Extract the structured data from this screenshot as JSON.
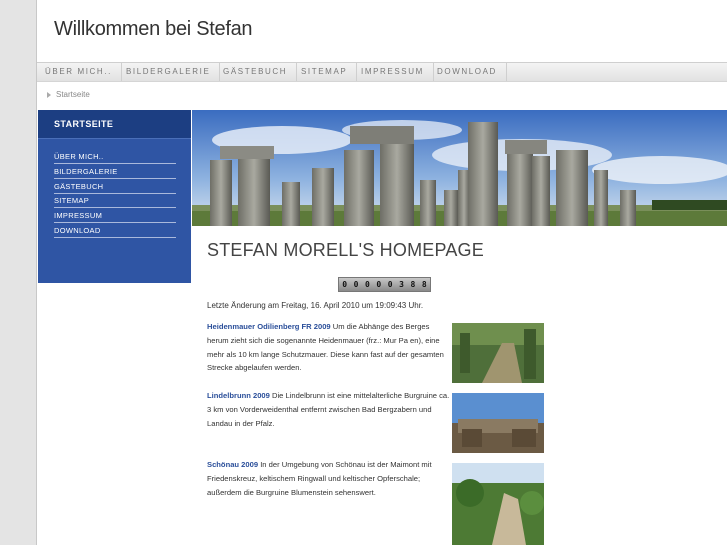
{
  "header": {
    "title": "Willkommen bei Stefan"
  },
  "topnav": [
    "ÜBER MICH..",
    "BILDERGALERIE",
    "GÄSTEBUCH",
    "SITEMAP",
    "IMPRESSUM",
    "DOWNLOAD"
  ],
  "breadcrumb": {
    "current": "Startseite"
  },
  "sidebar": {
    "heading": "STARTSEITE",
    "items": [
      "ÜBER MICH..",
      "BILDERGALERIE",
      "GÄSTEBUCH",
      "SITEMAP",
      "IMPRESSUM",
      "DOWNLOAD"
    ]
  },
  "main": {
    "heading": "STEFAN MORELL'S HOMEPAGE",
    "counter_digits": [
      "0",
      "0",
      "0",
      "0",
      "0",
      "3",
      "8",
      "8"
    ],
    "last_modified": "Letzte Änderung am Freitag, 16. April 2010 um 19:09:43 Uhr.",
    "news": [
      {
        "link": "Heidenmauer Odilienberg FR 2009",
        "text": " Um die Abhänge des Berges herum zieht sich die sogenannte Heidenmauer (frz.: Mur Pa en), eine mehr als 10 km lange Schutzmauer. Diese kann fast auf der gesamten Strecke abgelaufen werden."
      },
      {
        "link": "Lindelbrunn 2009",
        "text": " Die Lindelbrunn ist eine mittelalterliche Burgruine ca. 3 km von Vorderweidenthal entfernt zwischen Bad Bergzabern und Landau in der Pfalz."
      },
      {
        "link": "Schönau 2009",
        "text": " In der Umgebung von Schönau ist der Maimont mit Friedenskreuz, keltischem Ringwall und keltischer Opferschale; außerdem die Burgruine Blumenstein sehenswert."
      }
    ]
  },
  "colors": {
    "sidebar": "#2f55a4",
    "sidebar_head": "#1c3e82",
    "link": "#2b4f9a"
  }
}
